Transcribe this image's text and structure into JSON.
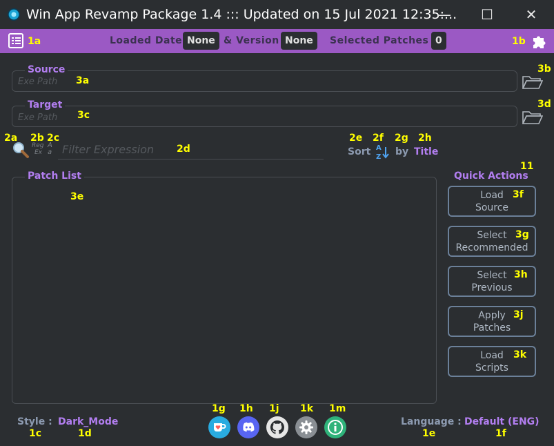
{
  "window": {
    "title": "Win App Revamp Package 1.4  :::  Updated on 15 Jul 2021 12:35:...",
    "minimize": "—",
    "maximize": "☐",
    "close": "✕"
  },
  "infobar": {
    "menu_annot": "1a",
    "loaded_date_label": "Loaded Date",
    "loaded_date_value": "None",
    "version_label": "& Version",
    "version_value": "None",
    "selected_patches_label": "Selected Patches",
    "selected_patches_value": "0",
    "plugin_annot": "1b"
  },
  "source": {
    "legend": "Source",
    "placeholder": "Exe Path",
    "annot": "3a",
    "browse_annot": "3b"
  },
  "target": {
    "legend": "Target",
    "placeholder": "Exe Path",
    "annot": "3c",
    "browse_annot": "3d"
  },
  "filter": {
    "search_annot": "2a",
    "regex_annot": "2b",
    "case_annot": "2c",
    "regex_label_top": "Reg",
    "regex_label_bottom": "Ex",
    "case_label_top": "A",
    "case_label_bottom": "a",
    "placeholder": "Filter Expression",
    "input_annot": "2d",
    "sort_annot": "2e",
    "sortdir_annot": "2f",
    "by_annot": "2g",
    "field_annot": "2h",
    "sort_label": "Sort",
    "by_label": "by",
    "field_value": "Title"
  },
  "patch_list": {
    "legend": "Patch List",
    "annot": "3e"
  },
  "quick_actions": {
    "title": "Quick Actions",
    "annot": "11",
    "buttons": [
      {
        "line1": "Load",
        "line2": "Source",
        "annot": "3f"
      },
      {
        "line1": "Select",
        "line2": "Recommended",
        "annot": "3g"
      },
      {
        "line1": "Select",
        "line2": "Previous",
        "annot": "3h"
      },
      {
        "line1": "Apply",
        "line2": "Patches",
        "annot": "3j"
      },
      {
        "line1": "Load",
        "line2": "Scripts",
        "annot": "3k"
      }
    ]
  },
  "footer": {
    "style_label": "Style :",
    "style_value": "Dark_Mode",
    "style_label_annot": "1c",
    "style_value_annot": "1d",
    "language_label": "Language :",
    "language_value": "Default (ENG)",
    "language_label_annot": "1e",
    "language_value_annot": "1f",
    "icons": [
      {
        "name": "kofi-icon",
        "annot": "1g",
        "color": "#29abe0"
      },
      {
        "name": "discord-icon",
        "annot": "1h",
        "color": "#5865f2"
      },
      {
        "name": "github-icon",
        "annot": "1j",
        "color": "#e6e6e6"
      },
      {
        "name": "settings-icon",
        "annot": "1k",
        "color": "#8a8f94"
      },
      {
        "name": "info-icon",
        "annot": "1m",
        "color": "#2fb37a"
      }
    ]
  },
  "colors": {
    "accent": "#9b59c4",
    "legend": "#b27ef0",
    "background": "#2b2e31",
    "annotation": "#ffff00"
  }
}
